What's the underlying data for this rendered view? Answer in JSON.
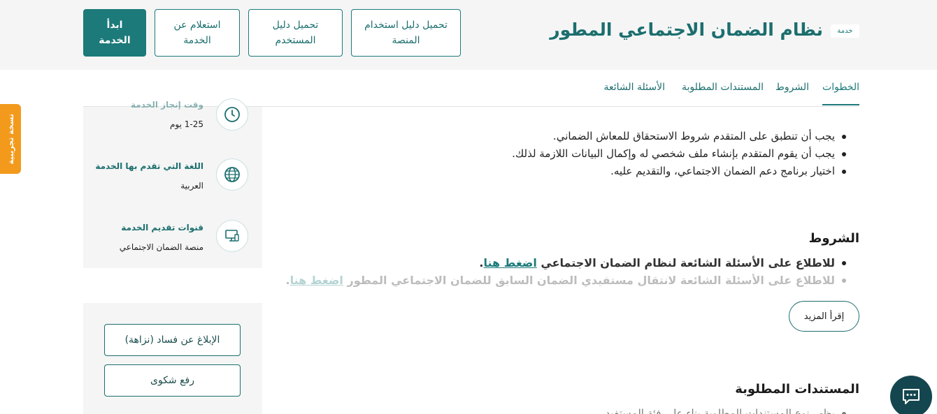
{
  "header": {
    "badge": "خدمة",
    "title": "نظام الضمان الاجتماعي المطور",
    "buttons": {
      "platform_guide": "تحميل دليل استخدام المنصة",
      "user_guide": "تحميل دليل المستخدم",
      "inquiry": "استعلام عن الخدمة",
      "start": "ابدأ الخدمة"
    }
  },
  "tabs": {
    "steps": "الخطوات",
    "conditions": "الشروط",
    "documents": "المستندات المطلوبة",
    "faq": "الأسئلة الشائعة"
  },
  "steps": [
    "يجب أن تنطبق على المتقدم شروط الاستحقاق للمعاش الضماني.",
    "يجب أن يقوم المتقدم بإنشاء ملف شخصي له وإكمال البيانات اللازمة لذلك.",
    "اختيار برنامج دعم الضمان الاجتماعي، والتقديم عليه."
  ],
  "conditions": {
    "title": "الشروط",
    "items": [
      {
        "text": "للاطلاع على الأسئلة الشائعة لنظام الضمان الاجتماعي ",
        "link": "اضغط هنا",
        "suffix": "."
      },
      {
        "text": "للاطلاع على الأسئلة الشائعة لانتقال مستفيدي الضمان السابق للضمان الاجتماعي المطور ",
        "link": "اضغط هنا",
        "suffix": "."
      }
    ],
    "read_more": "إقرأ المزيد"
  },
  "documents": {
    "title": "المستندات المطلوبة",
    "first_line": "يظهر نوع المستندات المطلوبة بناء على فئة المستفيد"
  },
  "sidebar": {
    "duration": {
      "label": "وقت إنجاز الخدمة",
      "value": "1-25 يوم"
    },
    "language": {
      "label": "اللغة التي تقدم بها الخدمة",
      "value": "العربية"
    },
    "channels": {
      "label": "قنوات تقديم الخدمة",
      "value": "منصة الضمان الاجتماعي"
    },
    "report_corruption": "الإبلاغ عن فساد (نزاهة)",
    "complaint": "رفع شكوى"
  },
  "beta_label": "نسخة تجريبية",
  "colors": {
    "primary": "#1c7a7a",
    "dark": "#14464f",
    "beta": "#f39a1c",
    "panel": "#f5f5f5"
  }
}
